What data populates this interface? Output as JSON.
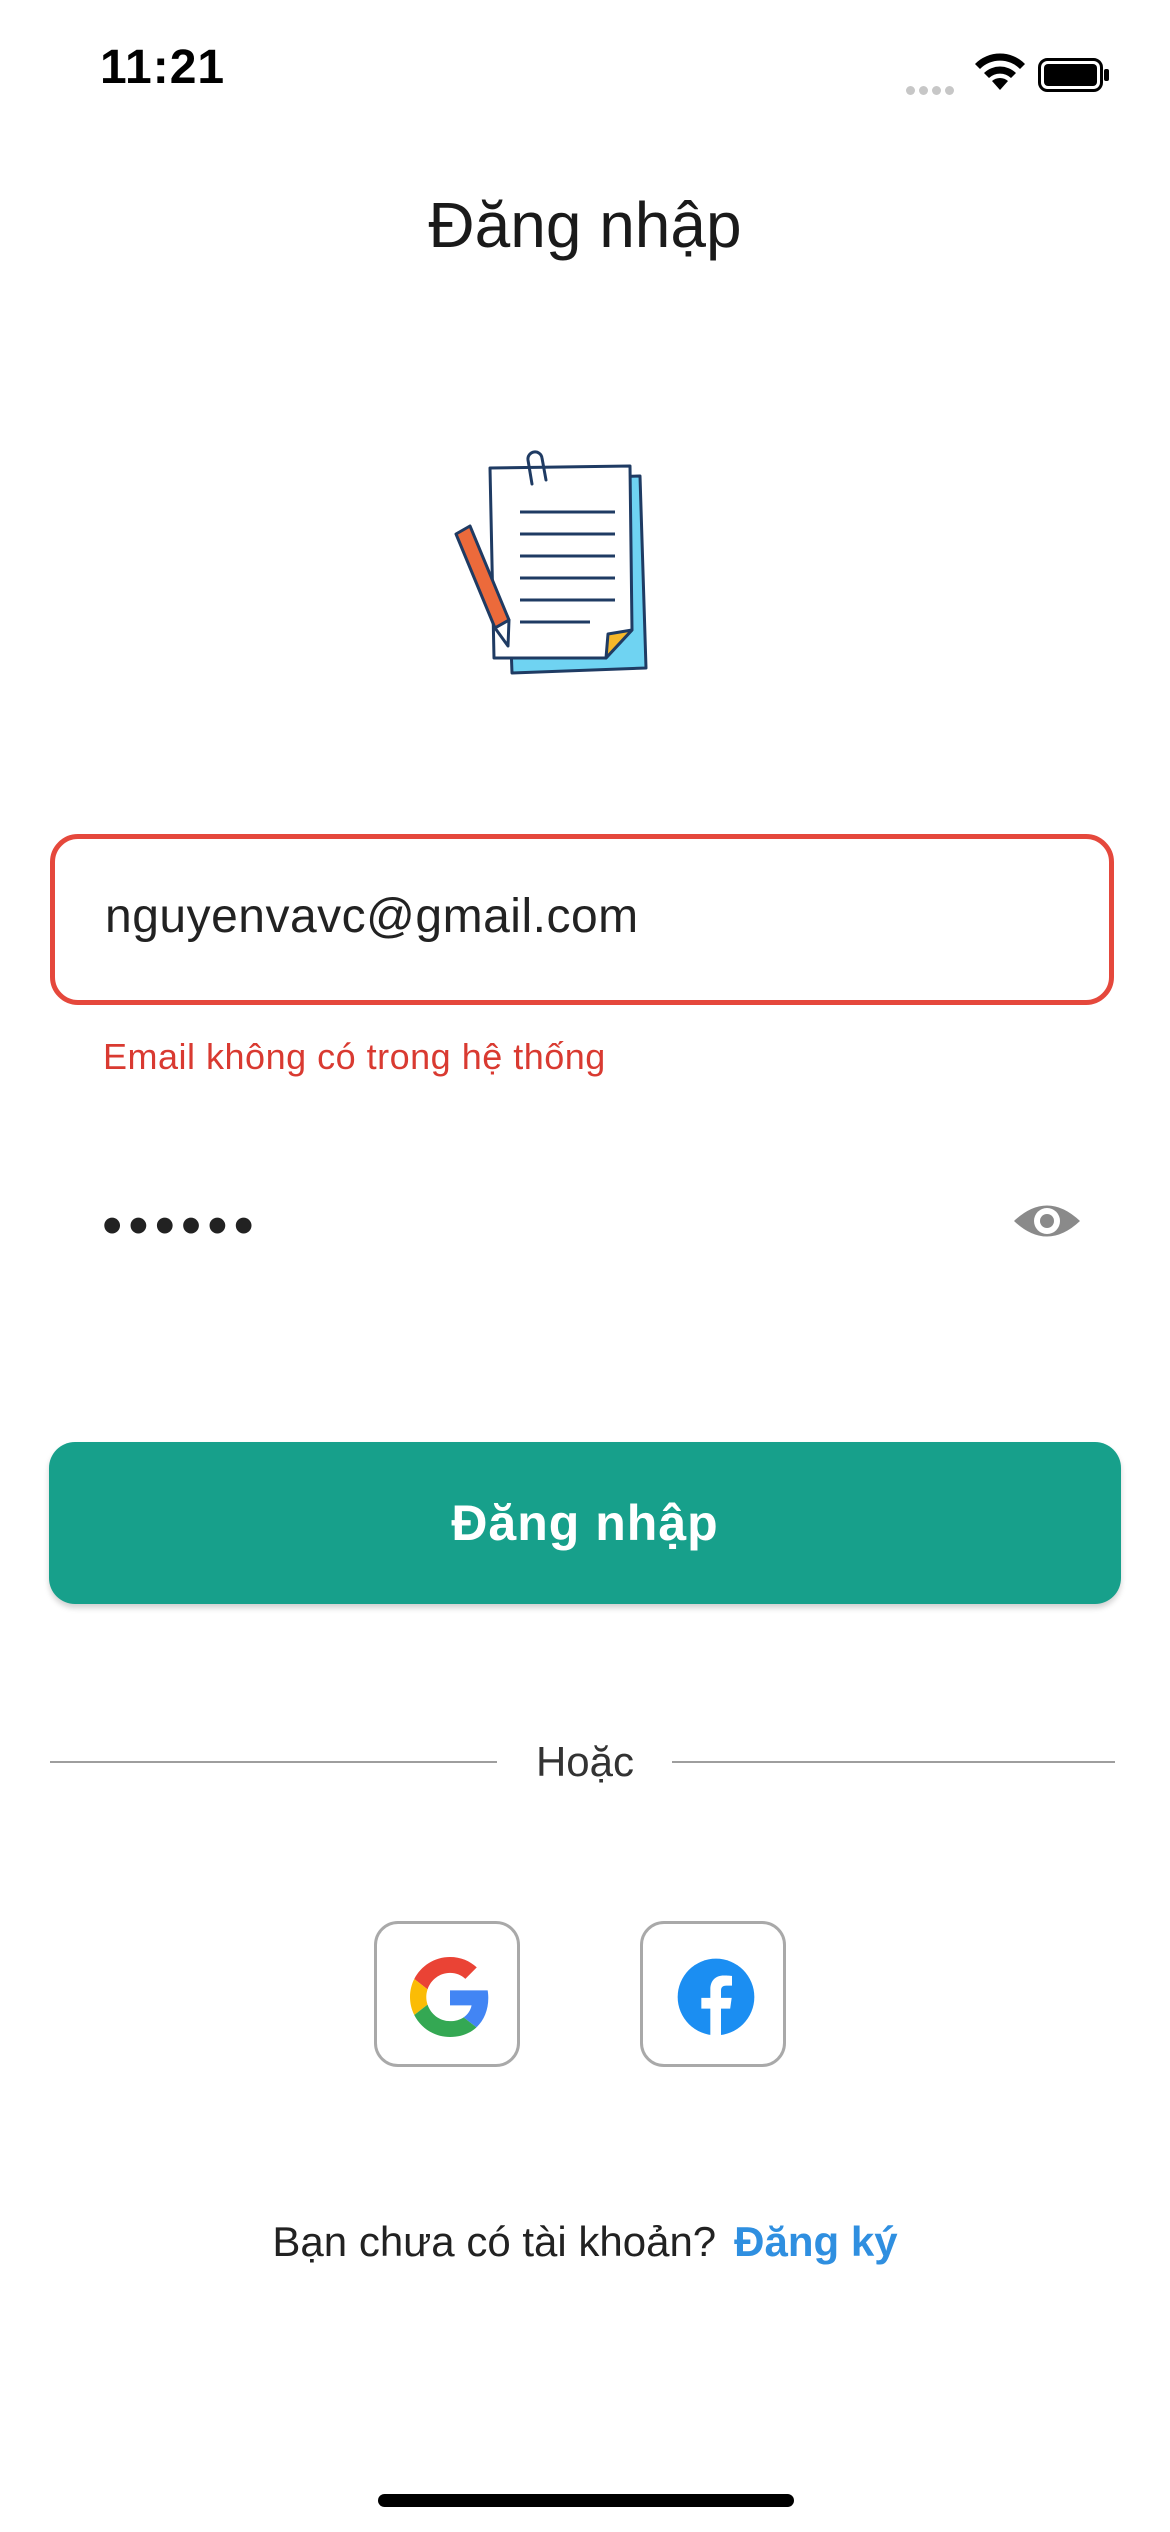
{
  "status_bar": {
    "time": "11:21"
  },
  "header": {
    "title": "Đăng nhập"
  },
  "illustration": {
    "icon": "notepad-with-pencil-icon"
  },
  "form": {
    "email": {
      "value": "nguyenvavc@gmail.com",
      "error": "Email không có trong hệ thống",
      "error_color": "#e5483c"
    },
    "password": {
      "value": "••••••",
      "toggle_icon": "eye-icon"
    },
    "submit_label": "Đăng nhập",
    "submit_color": "#17a08b"
  },
  "divider": {
    "text": "Hoặc"
  },
  "social": [
    {
      "provider": "google",
      "icon": "google-icon"
    },
    {
      "provider": "facebook",
      "icon": "facebook-icon"
    }
  ],
  "signup": {
    "prompt": "Bạn chưa có tài khoản?",
    "link_label": "Đăng ký",
    "link_color": "#2f8fe0"
  }
}
